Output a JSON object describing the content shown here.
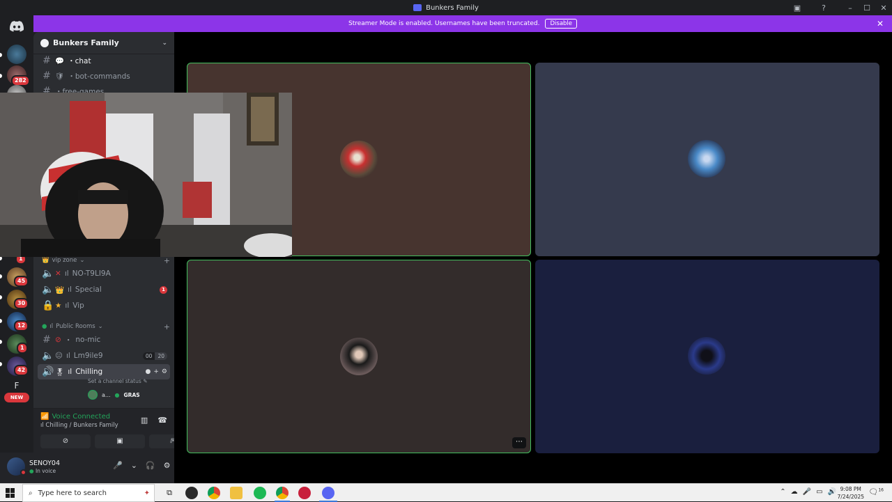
{
  "window": {
    "title": "Bunkers Family",
    "controls": [
      "screen-share-icon",
      "help-icon",
      "minimize",
      "maximize",
      "close"
    ]
  },
  "banner": {
    "text": "Streamer Mode is enabled. Usernames have been truncated.",
    "button": "Disable",
    "color": "#8c35e8"
  },
  "server": {
    "name": "Bunkers Family",
    "channels_top": [
      {
        "type": "text",
        "name": "・chat",
        "active": true
      },
      {
        "type": "text",
        "name": "・bot-commands",
        "active": false
      },
      {
        "type": "text",
        "name": "・free-games",
        "active": false
      }
    ],
    "categories": [
      {
        "name": "vip zone",
        "channels": [
          {
            "type": "voice",
            "name": "NO-T9LI9A",
            "prefix": "ıl"
          },
          {
            "type": "voice",
            "name": "Special",
            "prefix": "ıl",
            "mention": "1"
          },
          {
            "type": "locked",
            "name": "Vip",
            "prefix": "ıl"
          }
        ]
      },
      {
        "name": "Public Rooms",
        "channels": [
          {
            "type": "text",
            "name": "no-mic",
            "prefix": "・"
          },
          {
            "type": "voice",
            "name": "Lm9ile9",
            "prefix": "ıl",
            "counter": [
              "00",
              "20"
            ]
          },
          {
            "type": "voice",
            "name": "Chilling",
            "prefix": "ıl",
            "selected": true,
            "status": "Set a channel status"
          }
        ]
      }
    ],
    "voice_user": {
      "name": "a...",
      "tag": "GRAS"
    }
  },
  "guild_badges": [
    "282",
    "1",
    "45",
    "30",
    "12",
    "1",
    "42"
  ],
  "guild_new_label": "NEW",
  "guild_letter": "F",
  "voice_panel": {
    "title": "Voice Connected",
    "subtitle": "ıl Chilling / Bunkers Family",
    "status_color": "#23a55a"
  },
  "user_panel": {
    "name": "SENOY04",
    "status": "In voice"
  },
  "tiles": [
    {
      "bg": "#47342f",
      "speaking": true,
      "avatar": "avatar-red-mask"
    },
    {
      "bg": "#353a4d",
      "speaking": false,
      "avatar": "avatar-blue-character"
    },
    {
      "bg": "#332c2b",
      "speaking": true,
      "avatar": "avatar-hooded-person"
    },
    {
      "bg": "#1a1f3e",
      "speaking": false,
      "avatar": "avatar-dark-character"
    }
  ],
  "taskbar": {
    "search_placeholder": "Type here to search",
    "time": "9:08 PM",
    "date": "7/24/2025",
    "notification_count": "16"
  }
}
